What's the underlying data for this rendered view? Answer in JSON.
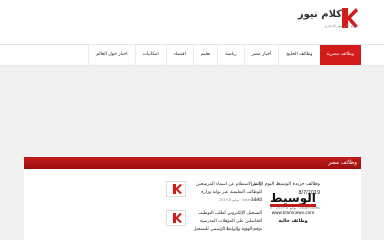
{
  "site": {
    "logo_text": "كلام نيوز",
    "logo_sub": "موقع كلام نيوز الإخباري"
  },
  "nav": {
    "items": [
      {
        "label": "وظائف مصرية",
        "active": true
      },
      {
        "label": "وظائف الخليج"
      },
      {
        "label": "أخبار مصر"
      },
      {
        "label": "رياضة"
      },
      {
        "label": "تعليم"
      },
      {
        "label": "اقتصاد"
      },
      {
        "label": "امكانيات"
      },
      {
        "label": "اخبار حول العالم"
      }
    ]
  },
  "section": {
    "title": "وظائف مصر"
  },
  "featured": {
    "title": "وظائف جريدة الوسيط اليوم الاثنين 8/7/2019",
    "meta": "kalamnews · يوليو 8 2019 · 0",
    "image_brand": "الوسيط",
    "image_site": "www.klamnews.com",
    "image_caption": "وظائف خالية"
  },
  "list": [
    {
      "title": "رابط الاستعلام عن اسماء المرشحين للوظائف التعليمية عبر بوابة وزارة 1440",
      "meta": "kalamnews · يوليو 8 2019"
    },
    {
      "title": "التسجيل الإلكتروني لطلب التوظيف للحاصلين على المؤهلات المدرسية برقم الهوية والرابط الرسمي للتسجيل",
      "meta": "kalamnews · يوليو 8 2019"
    }
  ]
}
